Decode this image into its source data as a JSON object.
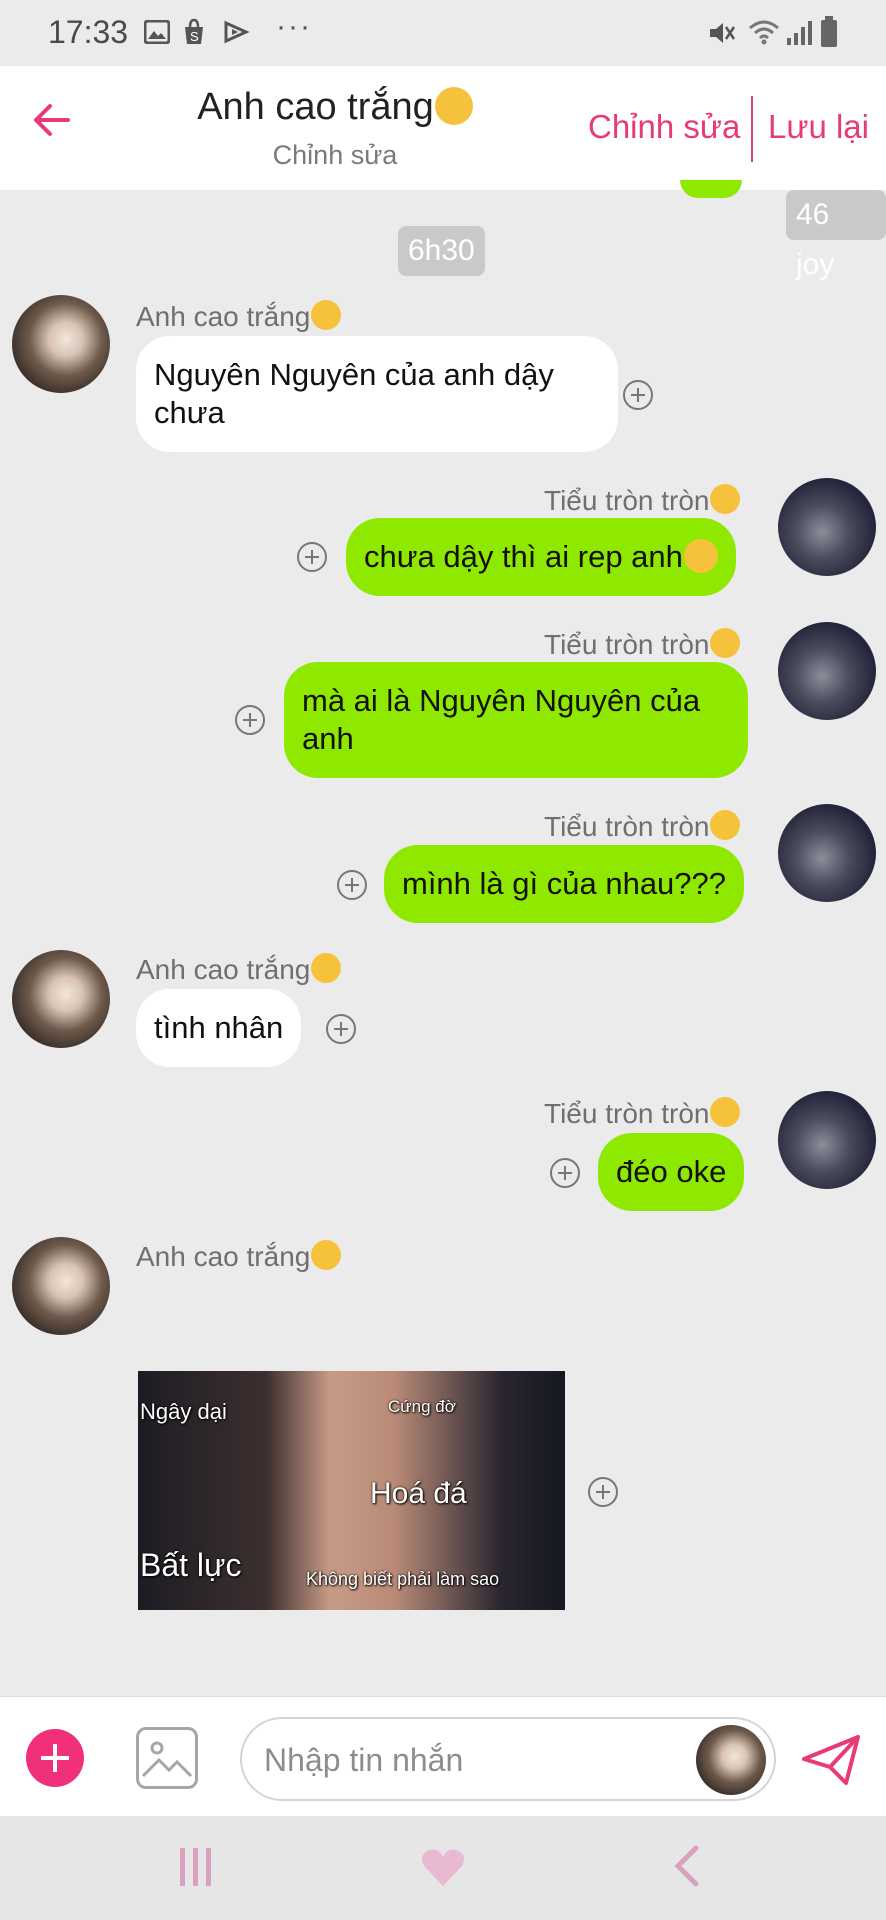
{
  "status_bar": {
    "time": "17:33",
    "icons": [
      "image-icon",
      "shopee-icon",
      "play-icon",
      "more-icon",
      "mute-icon",
      "wifi-icon",
      "signal-icon",
      "battery-icon"
    ],
    "more_glyph": "···"
  },
  "header": {
    "title": "Anh cao trắng",
    "subtitle": "Chỉnh sửa",
    "edit_label": "Chỉnh sửa",
    "save_label": "Lưu lại",
    "accent_color": "#e8397a"
  },
  "chat": {
    "partial_badge": "46 joy",
    "time_badge": "6h30",
    "messages": [
      {
        "side": "left",
        "sender": "Anh cao trắng",
        "text_line1": "Nguyên Nguyên của anh dậy",
        "text_line2": "chưa"
      },
      {
        "side": "right",
        "sender": "Tiểu tròn tròn",
        "text": "chưa dậy thì ai rep anh"
      },
      {
        "side": "right",
        "sender": "Tiểu tròn tròn",
        "text_line1": "mà ai là Nguyên Nguyên của",
        "text_line2": "anh"
      },
      {
        "side": "right",
        "sender": "Tiểu tròn tròn",
        "text": "mình là gì của nhau???"
      },
      {
        "side": "left",
        "sender": "Anh cao trắng",
        "text": "tình nhân"
      },
      {
        "side": "right",
        "sender": "Tiểu tròn tròn",
        "text": "đéo oke"
      },
      {
        "side": "left",
        "sender": "Anh cao trắng",
        "type": "image",
        "image_captions": {
          "top_left": "Ngây dại",
          "top_right": "Cứng đờ",
          "center": "Hoá đá",
          "bottom_left": "Bất lực",
          "bottom_right": "Không biết phải làm sao"
        }
      }
    ],
    "incoming_color": "#ffffff",
    "outgoing_color": "#8fe800"
  },
  "composer": {
    "placeholder": "Nhập tin nhắn",
    "add_color": "#f0307a"
  },
  "nav": {
    "icons": [
      "recent-apps-icon",
      "home-heart-icon",
      "back-nav-icon"
    ]
  }
}
